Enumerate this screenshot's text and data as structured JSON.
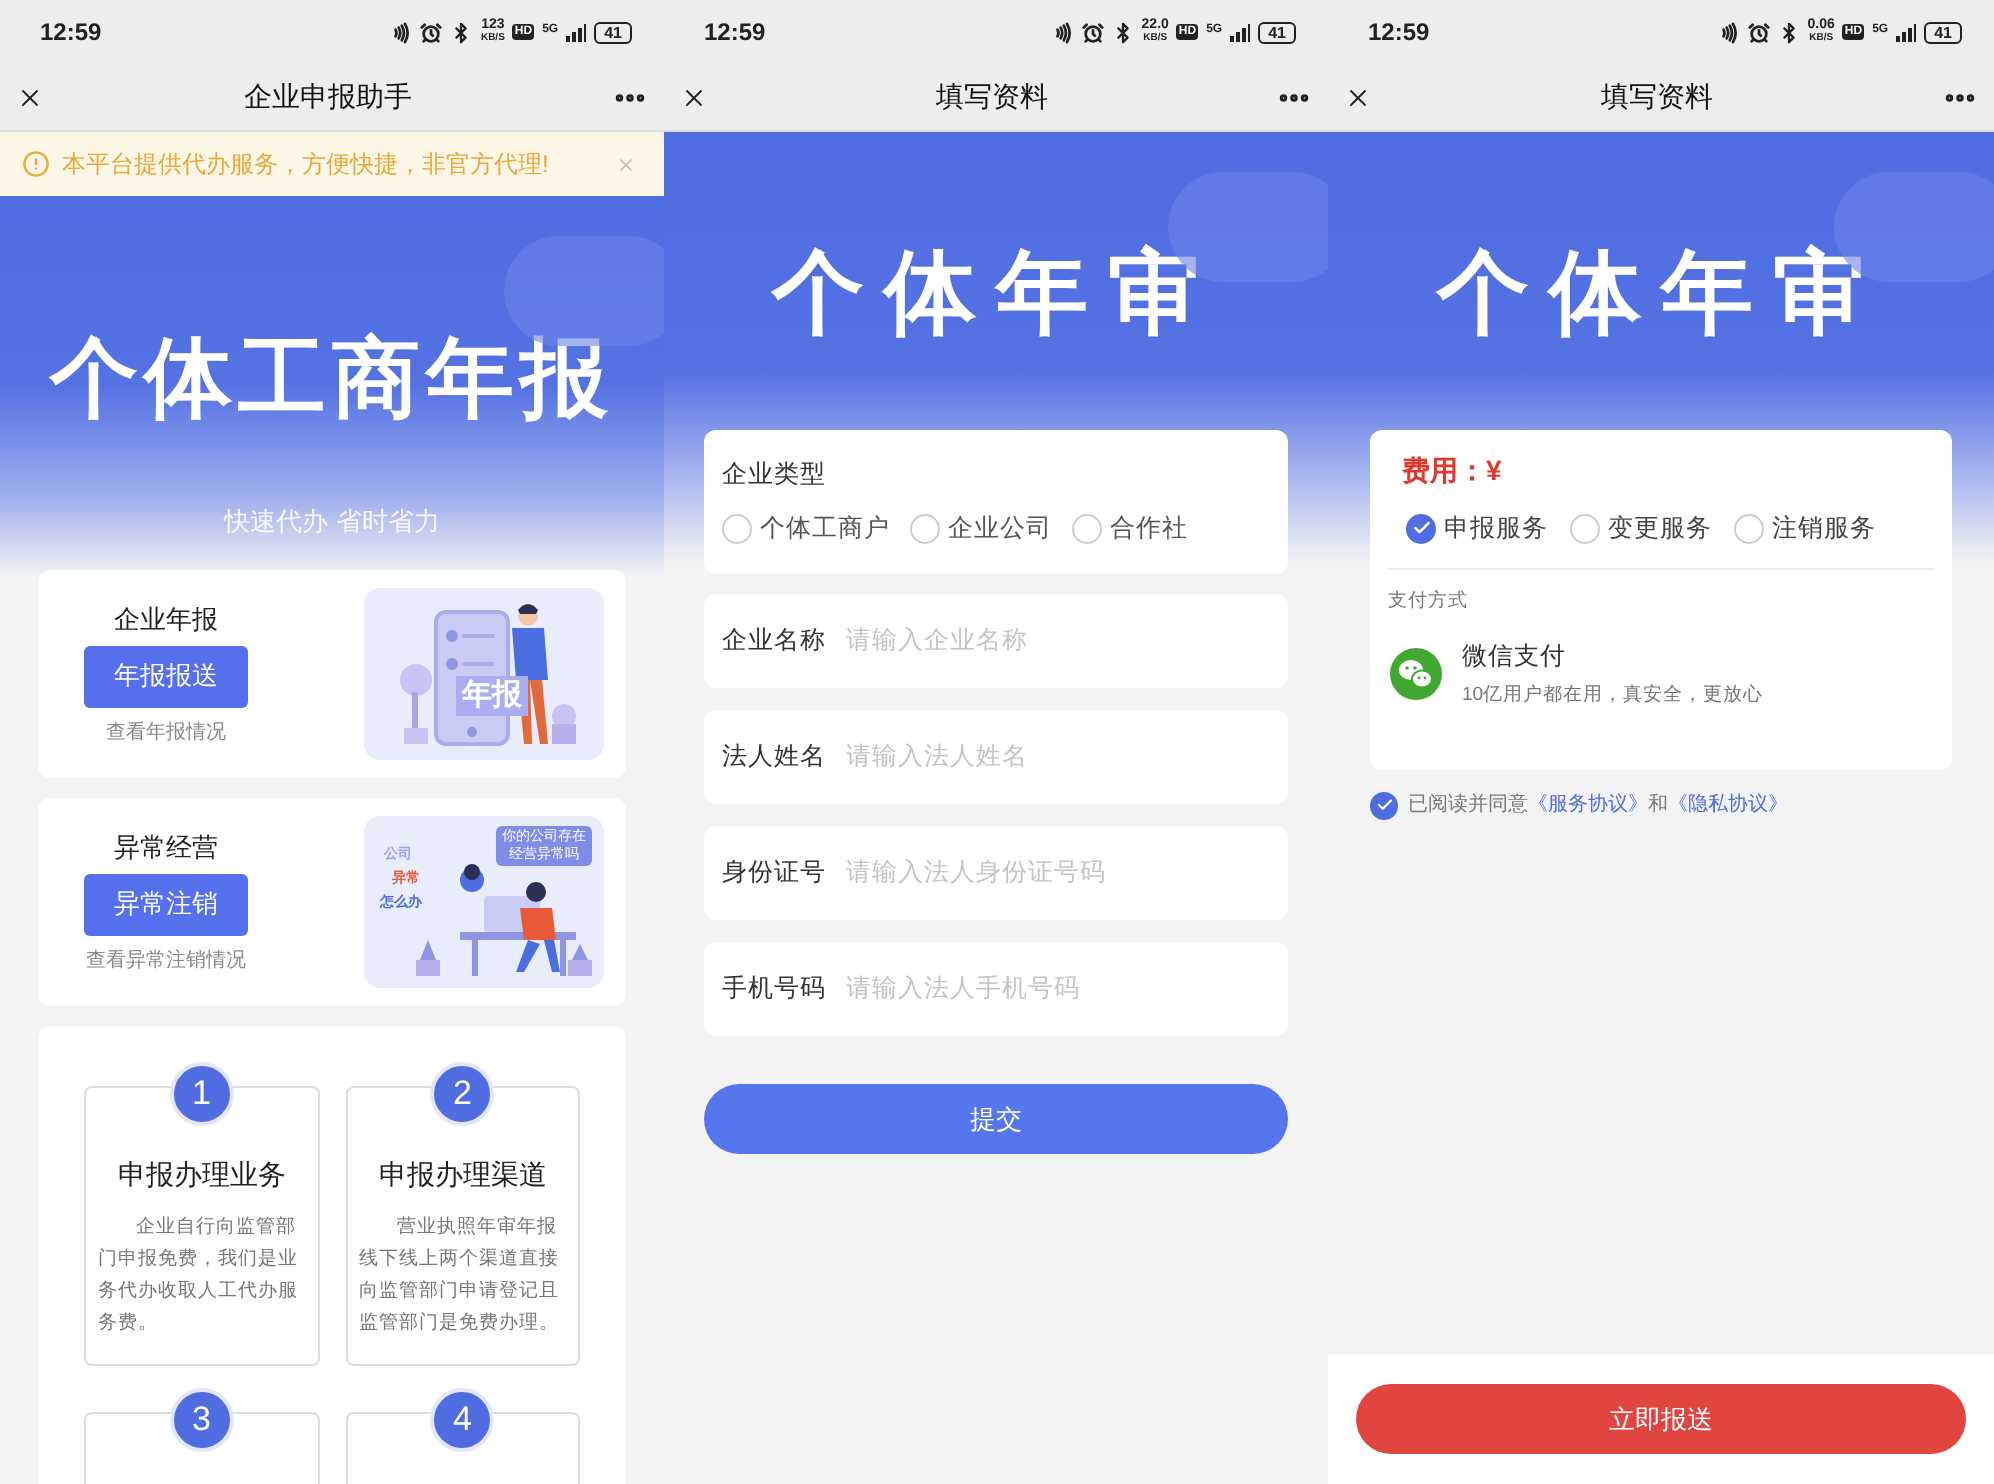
{
  "home": {
    "status_bar": {
      "time": "12:59",
      "speed": "123",
      "speed_unit": "KB/S",
      "hd": "HD",
      "network": "5G",
      "battery": "41"
    },
    "nav": {
      "title": "企业申报助手"
    },
    "notice": {
      "text": "本平台提供代办服务，方便快捷，非官方代理!"
    },
    "hero": {
      "title": "个体工商年报",
      "subtitle": "快速代办 省时省力"
    },
    "services": [
      {
        "title": "企业年报",
        "button": "年报报送",
        "link": "查看年报情况",
        "illustration": {
          "kind": "report",
          "badge": "年报"
        }
      },
      {
        "title": "异常经营",
        "button": "异常注销",
        "link": "查看异常注销情况",
        "illustration": {
          "kind": "abnormal",
          "bubble": "你的公司存在经营异常吗",
          "words": [
            "公司",
            "异常",
            "怎么办"
          ]
        }
      }
    ],
    "steps": [
      {
        "number": "1",
        "title": "申报办理业务",
        "text": "企业自行向监管部门申报免费，我们是业务代办收取人工代办服务费。"
      },
      {
        "number": "2",
        "title": "申报办理渠道",
        "text": "营业执照年审年报线下线上两个渠道直接向监管部门申请登记且监管部门是免费办理。"
      },
      {
        "number": "3"
      },
      {
        "number": "4"
      }
    ]
  },
  "form": {
    "status_bar": {
      "time": "12:59",
      "speed": "22.0",
      "speed_unit": "KB/S",
      "hd": "HD",
      "network": "5G",
      "battery": "41"
    },
    "nav": {
      "title": "填写资料"
    },
    "hero": {
      "title": "个体年审"
    },
    "type_group": {
      "label": "企业类型",
      "options": [
        {
          "label": "个体工商户",
          "selected": false
        },
        {
          "label": "企业公司",
          "selected": false
        },
        {
          "label": "合作社",
          "selected": false
        }
      ]
    },
    "fields": [
      {
        "label": "企业名称",
        "placeholder": "请输入企业名称"
      },
      {
        "label": "法人姓名",
        "placeholder": "请输入法人姓名"
      },
      {
        "label": "身份证号",
        "placeholder": "请输入法人身份证号码"
      },
      {
        "label": "手机号码",
        "placeholder": "请输入法人手机号码"
      }
    ],
    "submit": "提交"
  },
  "payment": {
    "status_bar": {
      "time": "12:59",
      "speed": "0.06",
      "speed_unit": "KB/S",
      "hd": "HD",
      "network": "5G",
      "battery": "41"
    },
    "nav": {
      "title": "填写资料"
    },
    "hero": {
      "title": "个体年审"
    },
    "fee": "费用：¥",
    "services": [
      {
        "label": "申报服务",
        "selected": true
      },
      {
        "label": "变更服务",
        "selected": false
      },
      {
        "label": "注销服务",
        "selected": false
      }
    ],
    "payment_label": "支付方式",
    "method": {
      "name": "微信支付",
      "description": "10亿用户都在用，真安全，更放心"
    },
    "agreement": {
      "checked": true,
      "text": "已阅读并同意",
      "links": [
        "《服务协议》",
        "《隐私协议》"
      ],
      "joiner": "和"
    },
    "button": "立即报送"
  }
}
